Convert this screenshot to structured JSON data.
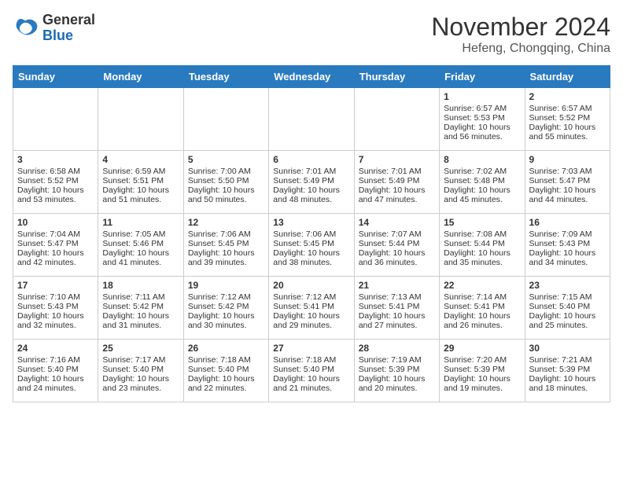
{
  "header": {
    "logo_general": "General",
    "logo_blue": "Blue",
    "title": "November 2024",
    "subtitle": "Hefeng, Chongqing, China"
  },
  "days_of_week": [
    "Sunday",
    "Monday",
    "Tuesday",
    "Wednesday",
    "Thursday",
    "Friday",
    "Saturday"
  ],
  "weeks": [
    [
      {
        "day": "",
        "sunrise": "",
        "sunset": "",
        "daylight": ""
      },
      {
        "day": "",
        "sunrise": "",
        "sunset": "",
        "daylight": ""
      },
      {
        "day": "",
        "sunrise": "",
        "sunset": "",
        "daylight": ""
      },
      {
        "day": "",
        "sunrise": "",
        "sunset": "",
        "daylight": ""
      },
      {
        "day": "",
        "sunrise": "",
        "sunset": "",
        "daylight": ""
      },
      {
        "day": "1",
        "sunrise": "Sunrise: 6:57 AM",
        "sunset": "Sunset: 5:53 PM",
        "daylight": "Daylight: 10 hours and 56 minutes."
      },
      {
        "day": "2",
        "sunrise": "Sunrise: 6:57 AM",
        "sunset": "Sunset: 5:52 PM",
        "daylight": "Daylight: 10 hours and 55 minutes."
      }
    ],
    [
      {
        "day": "3",
        "sunrise": "Sunrise: 6:58 AM",
        "sunset": "Sunset: 5:52 PM",
        "daylight": "Daylight: 10 hours and 53 minutes."
      },
      {
        "day": "4",
        "sunrise": "Sunrise: 6:59 AM",
        "sunset": "Sunset: 5:51 PM",
        "daylight": "Daylight: 10 hours and 51 minutes."
      },
      {
        "day": "5",
        "sunrise": "Sunrise: 7:00 AM",
        "sunset": "Sunset: 5:50 PM",
        "daylight": "Daylight: 10 hours and 50 minutes."
      },
      {
        "day": "6",
        "sunrise": "Sunrise: 7:01 AM",
        "sunset": "Sunset: 5:49 PM",
        "daylight": "Daylight: 10 hours and 48 minutes."
      },
      {
        "day": "7",
        "sunrise": "Sunrise: 7:01 AM",
        "sunset": "Sunset: 5:49 PM",
        "daylight": "Daylight: 10 hours and 47 minutes."
      },
      {
        "day": "8",
        "sunrise": "Sunrise: 7:02 AM",
        "sunset": "Sunset: 5:48 PM",
        "daylight": "Daylight: 10 hours and 45 minutes."
      },
      {
        "day": "9",
        "sunrise": "Sunrise: 7:03 AM",
        "sunset": "Sunset: 5:47 PM",
        "daylight": "Daylight: 10 hours and 44 minutes."
      }
    ],
    [
      {
        "day": "10",
        "sunrise": "Sunrise: 7:04 AM",
        "sunset": "Sunset: 5:47 PM",
        "daylight": "Daylight: 10 hours and 42 minutes."
      },
      {
        "day": "11",
        "sunrise": "Sunrise: 7:05 AM",
        "sunset": "Sunset: 5:46 PM",
        "daylight": "Daylight: 10 hours and 41 minutes."
      },
      {
        "day": "12",
        "sunrise": "Sunrise: 7:06 AM",
        "sunset": "Sunset: 5:45 PM",
        "daylight": "Daylight: 10 hours and 39 minutes."
      },
      {
        "day": "13",
        "sunrise": "Sunrise: 7:06 AM",
        "sunset": "Sunset: 5:45 PM",
        "daylight": "Daylight: 10 hours and 38 minutes."
      },
      {
        "day": "14",
        "sunrise": "Sunrise: 7:07 AM",
        "sunset": "Sunset: 5:44 PM",
        "daylight": "Daylight: 10 hours and 36 minutes."
      },
      {
        "day": "15",
        "sunrise": "Sunrise: 7:08 AM",
        "sunset": "Sunset: 5:44 PM",
        "daylight": "Daylight: 10 hours and 35 minutes."
      },
      {
        "day": "16",
        "sunrise": "Sunrise: 7:09 AM",
        "sunset": "Sunset: 5:43 PM",
        "daylight": "Daylight: 10 hours and 34 minutes."
      }
    ],
    [
      {
        "day": "17",
        "sunrise": "Sunrise: 7:10 AM",
        "sunset": "Sunset: 5:43 PM",
        "daylight": "Daylight: 10 hours and 32 minutes."
      },
      {
        "day": "18",
        "sunrise": "Sunrise: 7:11 AM",
        "sunset": "Sunset: 5:42 PM",
        "daylight": "Daylight: 10 hours and 31 minutes."
      },
      {
        "day": "19",
        "sunrise": "Sunrise: 7:12 AM",
        "sunset": "Sunset: 5:42 PM",
        "daylight": "Daylight: 10 hours and 30 minutes."
      },
      {
        "day": "20",
        "sunrise": "Sunrise: 7:12 AM",
        "sunset": "Sunset: 5:41 PM",
        "daylight": "Daylight: 10 hours and 29 minutes."
      },
      {
        "day": "21",
        "sunrise": "Sunrise: 7:13 AM",
        "sunset": "Sunset: 5:41 PM",
        "daylight": "Daylight: 10 hours and 27 minutes."
      },
      {
        "day": "22",
        "sunrise": "Sunrise: 7:14 AM",
        "sunset": "Sunset: 5:41 PM",
        "daylight": "Daylight: 10 hours and 26 minutes."
      },
      {
        "day": "23",
        "sunrise": "Sunrise: 7:15 AM",
        "sunset": "Sunset: 5:40 PM",
        "daylight": "Daylight: 10 hours and 25 minutes."
      }
    ],
    [
      {
        "day": "24",
        "sunrise": "Sunrise: 7:16 AM",
        "sunset": "Sunset: 5:40 PM",
        "daylight": "Daylight: 10 hours and 24 minutes."
      },
      {
        "day": "25",
        "sunrise": "Sunrise: 7:17 AM",
        "sunset": "Sunset: 5:40 PM",
        "daylight": "Daylight: 10 hours and 23 minutes."
      },
      {
        "day": "26",
        "sunrise": "Sunrise: 7:18 AM",
        "sunset": "Sunset: 5:40 PM",
        "daylight": "Daylight: 10 hours and 22 minutes."
      },
      {
        "day": "27",
        "sunrise": "Sunrise: 7:18 AM",
        "sunset": "Sunset: 5:40 PM",
        "daylight": "Daylight: 10 hours and 21 minutes."
      },
      {
        "day": "28",
        "sunrise": "Sunrise: 7:19 AM",
        "sunset": "Sunset: 5:39 PM",
        "daylight": "Daylight: 10 hours and 20 minutes."
      },
      {
        "day": "29",
        "sunrise": "Sunrise: 7:20 AM",
        "sunset": "Sunset: 5:39 PM",
        "daylight": "Daylight: 10 hours and 19 minutes."
      },
      {
        "day": "30",
        "sunrise": "Sunrise: 7:21 AM",
        "sunset": "Sunset: 5:39 PM",
        "daylight": "Daylight: 10 hours and 18 minutes."
      }
    ]
  ]
}
